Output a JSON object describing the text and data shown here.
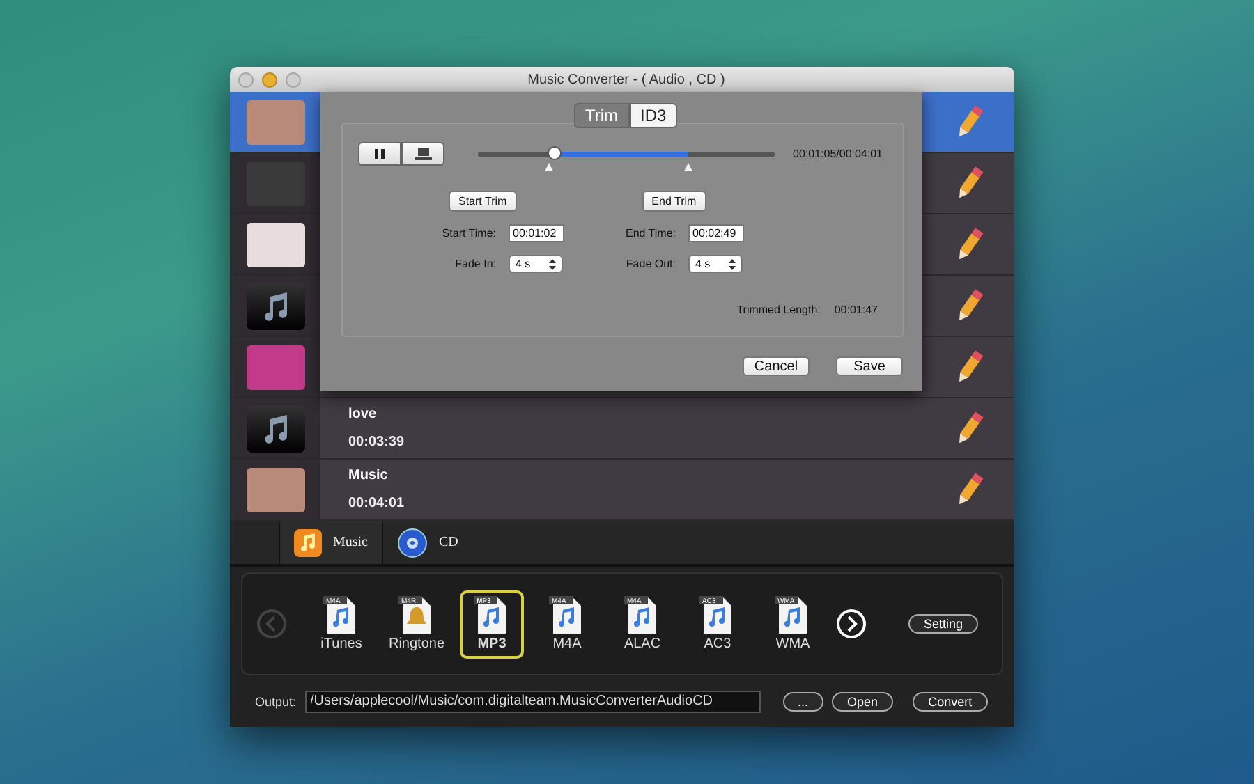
{
  "window": {
    "title": "Music Converter - ( Audio , CD )"
  },
  "tracks": [
    {
      "kind": "art",
      "color": "#b88a7a",
      "selected": true
    },
    {
      "kind": "art",
      "color": "#3a3a3a",
      "selected": false
    },
    {
      "kind": "art",
      "color": "#e8dcdc",
      "selected": false
    },
    {
      "kind": "note",
      "selected": false
    },
    {
      "kind": "art",
      "color": "#c23a8a",
      "selected": false
    },
    {
      "kind": "note",
      "title": "love",
      "duration": "00:03:39",
      "selected": false
    },
    {
      "kind": "art",
      "color": "#b88a7a",
      "title": "Music",
      "duration": "00:04:01",
      "selected": false
    }
  ],
  "trim_sheet": {
    "tabs": [
      {
        "label": "Trim",
        "selected": true
      },
      {
        "label": "ID3",
        "selected": false
      }
    ],
    "playhead": {
      "level": 0.26
    },
    "trim_start": {
      "level": 0.24
    },
    "trim_end": {
      "level": 0.71
    },
    "position": "00:01:05/00:04:01",
    "start_trim": "Start Trim",
    "end_trim": "End Trim",
    "start_time": {
      "label": "Start Time:",
      "value": "00:01:02"
    },
    "end_time": {
      "label": "End Time:",
      "value": "00:02:49"
    },
    "fade_in": {
      "label": "Fade In:",
      "value": "4 s"
    },
    "fade_out": {
      "label": "Fade Out:",
      "value": "4 s"
    },
    "trimmed_length": {
      "label": "Trimmed Length:",
      "value": "00:01:47"
    },
    "buttons": [
      "Cancel",
      "Save"
    ]
  },
  "source_tabs": [
    {
      "label": "Music",
      "kind": "music",
      "selected": true
    },
    {
      "label": "CD",
      "kind": "cd",
      "selected": false
    }
  ],
  "formats": [
    {
      "label": "iTunes",
      "badge": "M4A",
      "kind": "note",
      "selected": false
    },
    {
      "label": "Ringtone",
      "badge": "M4R",
      "kind": "bell",
      "selected": false
    },
    {
      "label": "MP3",
      "badge": "MP3",
      "kind": "note",
      "selected": true
    },
    {
      "label": "M4A",
      "badge": "M4A",
      "kind": "note",
      "selected": false
    },
    {
      "label": "ALAC",
      "badge": "M4A",
      "kind": "note",
      "selected": false
    },
    {
      "label": "AC3",
      "badge": "AC3",
      "kind": "note",
      "selected": false
    },
    {
      "label": "WMA",
      "badge": "WMA",
      "kind": "note",
      "selected": false
    }
  ],
  "prev_disabled": true,
  "setting": "Setting",
  "output": {
    "label": "Output:",
    "path": "/Users/applecool/Music/com.digitalteam.MusicConverterAudioCD",
    "browse": "...",
    "open": "Open",
    "convert": "Convert"
  }
}
